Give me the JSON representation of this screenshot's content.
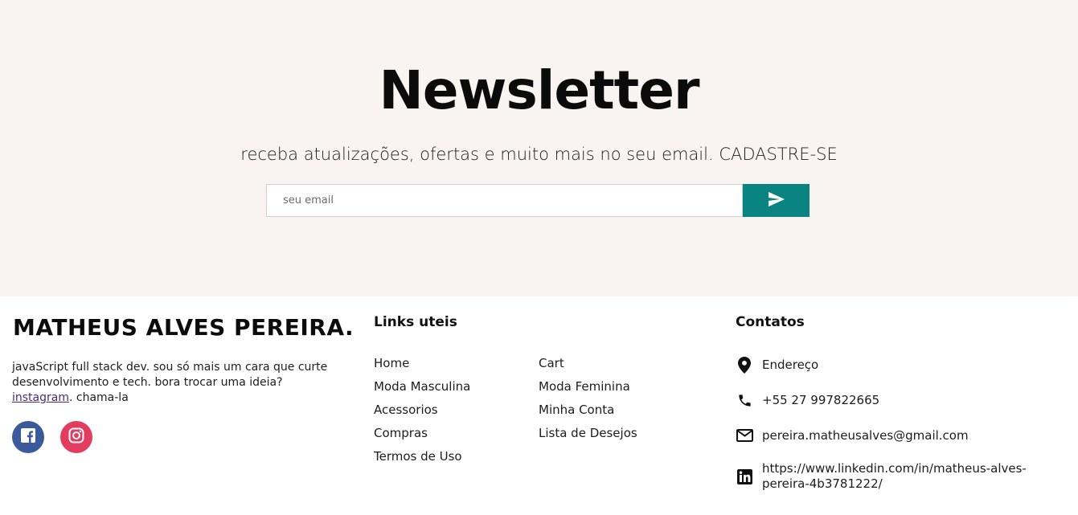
{
  "newsletter": {
    "title": "Newsletter",
    "subtitle": "receba atualizações, ofertas e muito mais no seu email. CADASTRE-SE",
    "email_placeholder": "seu email",
    "send_icon": "send-icon",
    "accent_color": "#0a8480",
    "background_color": "#f9f3f2"
  },
  "footer": {
    "brand": "MATHEUS ALVES PEREIRA.",
    "bio_text": "javaScript full stack dev. sou só mais um cara que curte desenvolvimento e tech. bora trocar uma ideia?",
    "bio_link": "instagram",
    "bio_suffix": ". chama-la",
    "social": [
      {
        "name": "facebook",
        "icon": "facebook-icon",
        "color": "#3b5a9b"
      },
      {
        "name": "instagram",
        "icon": "instagram-icon",
        "color": "#e23c5e"
      }
    ],
    "links_title": "Links uteis",
    "links_col1": [
      "Home",
      "Moda Masculina",
      "Acessorios",
      "Compras",
      "Termos de Uso"
    ],
    "links_col2": [
      "Cart",
      "Moda Feminina",
      "Minha Conta",
      "Lista de Desejos"
    ],
    "contacts_title": "Contatos",
    "contacts": {
      "address": "Endereço",
      "phone": "+55 27 997822665",
      "email": "pereira.matheusalves@gmail.com",
      "linkedin": "https://www.linkedin.com/in/matheus-alves-pereira-4b3781222/"
    }
  }
}
